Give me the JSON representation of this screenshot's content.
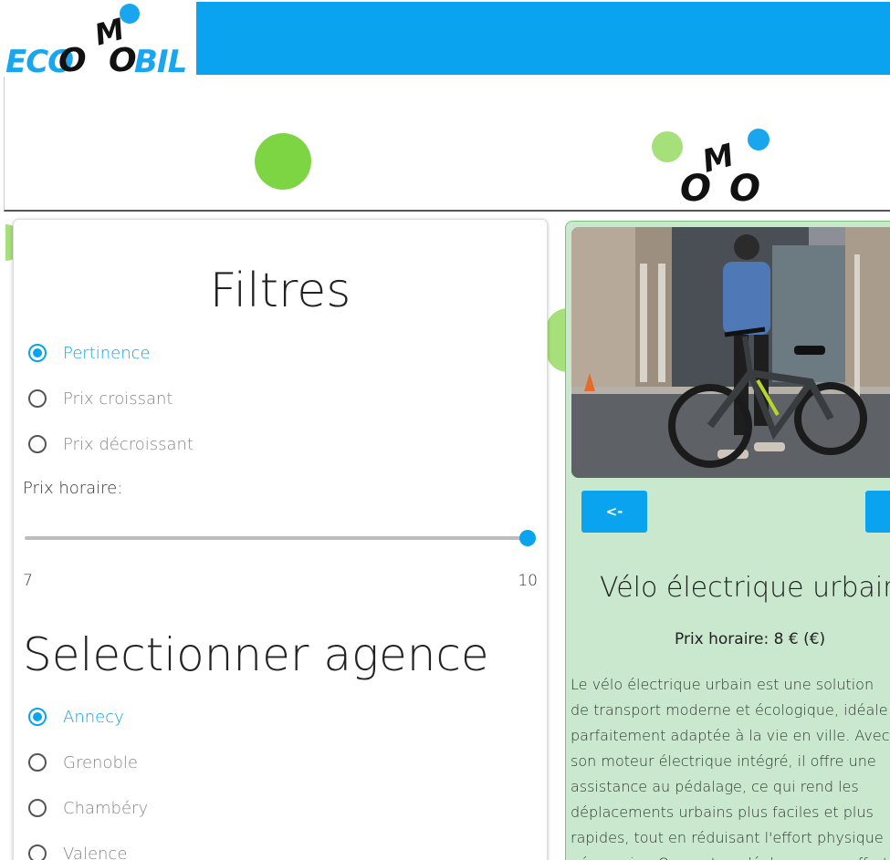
{
  "brand": {
    "logo_left": "ECO",
    "logo_o": "O",
    "logo_m": "M",
    "logo_right": "BIL",
    "accent_color": "#0aa3ef",
    "green_color": "#7ed544"
  },
  "filters": {
    "title": "Filtres",
    "sort_options": [
      {
        "label": "Pertinence",
        "checked": true
      },
      {
        "label": "Prix croissant",
        "checked": false
      },
      {
        "label": "Prix décroissant",
        "checked": false
      }
    ],
    "price_label": "Prix horaire:",
    "price_min": "7",
    "price_max": "10",
    "price_value": 10,
    "agency_title": "Selectionner agence",
    "agencies": [
      {
        "label": "Annecy",
        "checked": true
      },
      {
        "label": "Grenoble",
        "checked": false
      },
      {
        "label": "Chambéry",
        "checked": false
      },
      {
        "label": "Valence",
        "checked": false
      }
    ]
  },
  "product": {
    "prev_label": "<-",
    "next_label": "->",
    "title": "Vélo électrique urbain",
    "price": "Prix horaire: 8 € (€)",
    "description_lines": [
      "Le vélo électrique urbain est une solution",
      "de transport moderne et écologique, idéale",
      "parfaitement adaptée à la vie en ville. Avec",
      "son moteur électrique intégré, il offre une",
      "assistance au pédalage, ce qui rend les",
      "déplacements urbains plus faciles et plus",
      "rapides, tout en réduisant l'effort physique",
      "nécessaire. On peut se déplacer sans effort"
    ]
  }
}
